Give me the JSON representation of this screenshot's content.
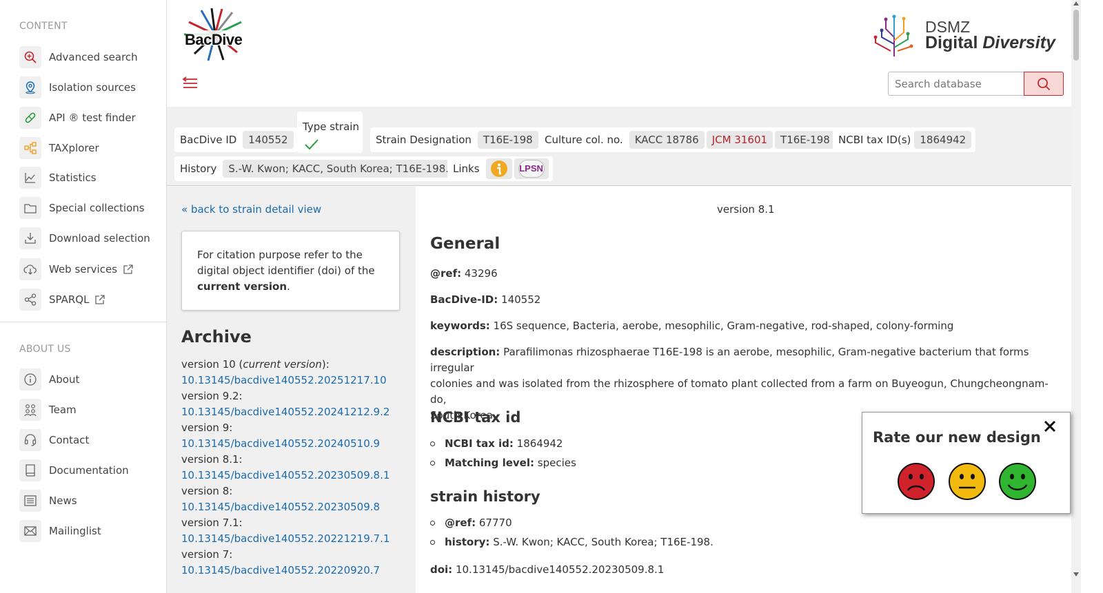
{
  "sidebar": {
    "content_title": "CONTENT",
    "content_items": [
      {
        "label": "Advanced search",
        "icon": "zoom-plus-icon"
      },
      {
        "label": "Isolation sources",
        "icon": "map-pin-icon"
      },
      {
        "label": "API ® test finder",
        "icon": "pill-icon"
      },
      {
        "label": "TAXplorer",
        "icon": "tree-icon"
      },
      {
        "label": "Statistics",
        "icon": "chart-line-icon"
      },
      {
        "label": "Special collections",
        "icon": "folder-icon"
      },
      {
        "label": "Download selection",
        "icon": "download-icon"
      },
      {
        "label": "Web services",
        "icon": "cloud-download-icon"
      },
      {
        "label": "SPARQL",
        "icon": "share-icon"
      }
    ],
    "about_title": "ABOUT US",
    "about_items": [
      {
        "label": "About",
        "icon": "info-icon"
      },
      {
        "label": "Team",
        "icon": "team-icon"
      },
      {
        "label": "Contact",
        "icon": "headset-icon"
      },
      {
        "label": "Documentation",
        "icon": "book-icon"
      },
      {
        "label": "News",
        "icon": "news-icon"
      },
      {
        "label": "Mailinglist",
        "icon": "mail-icon"
      }
    ]
  },
  "header": {
    "logo_text": "BacDive",
    "dsmz_line1": "DSMZ",
    "dsmz_line2a": "Digital",
    "dsmz_line2b": "Diversity",
    "search_placeholder": "Search database"
  },
  "tags": {
    "bacdive_id_label": "BacDive ID",
    "bacdive_id": "140552",
    "type_strain_label": "Type strain",
    "strain_designation_label": "Strain Designation",
    "strain_designation": "T16E-198",
    "culture_label": "Culture col. no.",
    "culture": [
      "KACC 18786",
      "JCM 31601",
      "T16E-198"
    ],
    "ncbi_label": "NCBI tax ID(s)",
    "ncbi": "1864942",
    "history_label": "History",
    "history": "S.-W. Kwon; KACC, South Korea; T16E-198.",
    "links_label": "Links",
    "lpsn": "LPSN"
  },
  "left": {
    "back_link": "« back to strain detail view",
    "cite_text_1": "For citation purpose refer to the digital object identifier (doi) of the ",
    "cite_bold": "current version",
    "cite_text_2": ".",
    "archive_title": "Archive",
    "versions": [
      {
        "label": "version 10 (",
        "italic": "current version",
        "end": "):",
        "doi": "10.13145/bacdive140552.20251217.10"
      },
      {
        "label": "version 9.2:",
        "doi": "10.13145/bacdive140552.20241212.9.2"
      },
      {
        "label": "version 9:",
        "doi": "10.13145/bacdive140552.20240510.9"
      },
      {
        "label": "version 8.1:",
        "doi": "10.13145/bacdive140552.20230509.8.1"
      },
      {
        "label": "version 8:",
        "doi": "10.13145/bacdive140552.20230509.8"
      },
      {
        "label": "version 7.1:",
        "doi": "10.13145/bacdive140552.20221219.7.1"
      },
      {
        "label": "version 7:",
        "doi": "10.13145/bacdive140552.20220920.7"
      }
    ]
  },
  "main": {
    "version": "version 8.1",
    "general_title": "General",
    "ref_label": "@ref:",
    "ref": "43296",
    "bacdive_id_label": "BacDive-ID:",
    "bacdive_id": "140552",
    "keywords_label": "keywords:",
    "keywords": "16S sequence, Bacteria, aerobe, mesophilic, Gram-negative, rod-shaped, colony-forming",
    "description_label": "description:",
    "description_l1": "Parafilimonas rhizosphaerae T16E-198 is an aerobe, mesophilic, Gram-negative bacterium that forms irregular",
    "description_l2": "colonies and was isolated from the rhizosphere of tomato plant collected from a farm on Buyeogun, Chungcheongnam-do,",
    "description_l3": "South Korea.",
    "ncbi_title": "NCBI tax id",
    "ncbi_label": "NCBI tax id:",
    "ncbi": "1864942",
    "matching_label": "Matching level:",
    "matching": "species",
    "history_title": "strain history",
    "hist_ref_label": "@ref:",
    "hist_ref": "67770",
    "history_label": "history:",
    "history": "S.-W. Kwon; KACC, South Korea; T16E-198.",
    "doi_label": "doi:",
    "doi": "10.13145/bacdive140552.20230509.8.1"
  },
  "popup": {
    "title": "Rate our new design",
    "colors": {
      "bad": "#d0222a",
      "neutral": "#f2b90f",
      "good": "#2fb52f"
    }
  }
}
